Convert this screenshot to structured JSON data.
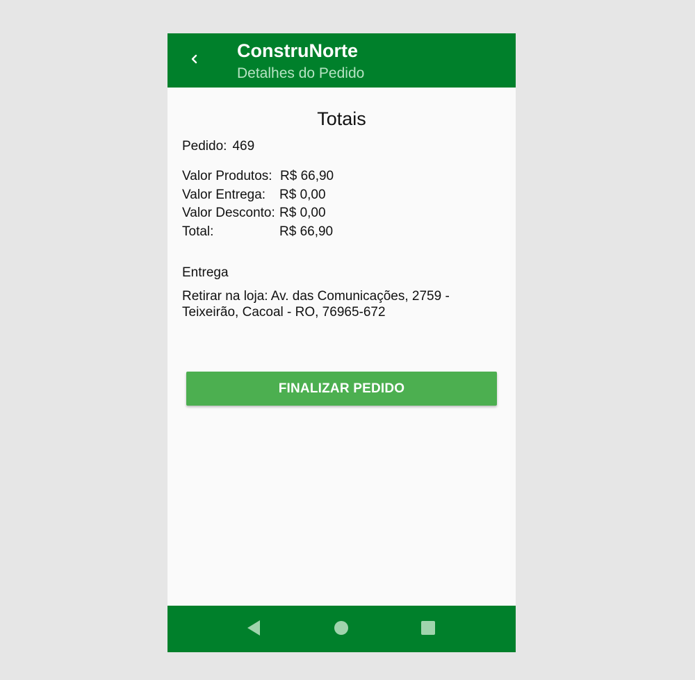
{
  "appbar": {
    "title": "ConstruNorte",
    "subtitle": "Detalhes do Pedido",
    "back_icon": "chevron-left-icon"
  },
  "totals": {
    "heading": "Totais",
    "order_label": "Pedido:",
    "order_number": "469",
    "rows": [
      {
        "label": "Valor Produtos:",
        "value": "R$ 66,90"
      },
      {
        "label": "Valor Entrega:",
        "value": "R$ 0,00"
      },
      {
        "label": "Valor Desconto:",
        "value": "R$ 0,00"
      },
      {
        "label": "Total:",
        "value": "R$ 66,90"
      }
    ]
  },
  "delivery": {
    "heading": "Entrega",
    "text": "Retirar na loja: Av. das Comunicações, 2759 - Teixeirão, Cacoal - RO, 76965-672"
  },
  "actions": {
    "finalize_label": "FINALIZAR PEDIDO"
  },
  "navbar": {
    "back_icon": "triangle-back-icon",
    "home_icon": "circle-home-icon",
    "recent_icon": "square-recents-icon"
  },
  "colors": {
    "primary": "#00802b",
    "button": "#4caf50",
    "subtitle": "#b6e3c3",
    "background": "#fafafa"
  }
}
